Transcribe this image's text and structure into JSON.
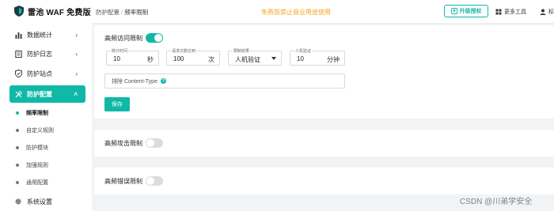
{
  "app": {
    "logo_text": "雷池 WAF 免费版"
  },
  "sidebar": {
    "items": [
      {
        "label": "数据统计",
        "icon": "bar-chart-icon"
      },
      {
        "label": "防护日志",
        "icon": "log-icon"
      },
      {
        "label": "防护站点",
        "icon": "shield-icon"
      },
      {
        "label": "防护配置",
        "icon": "tools-icon"
      },
      {
        "label": "系统设置",
        "icon": "gear-icon"
      }
    ],
    "sub_items": [
      {
        "label": "频率限制"
      },
      {
        "label": "自定义规则"
      },
      {
        "label": "防护模块"
      },
      {
        "label": "加强规则"
      },
      {
        "label": "通用配置"
      }
    ],
    "active_item": "防护配置",
    "active_sub_item": "频率限制",
    "accent": "#10b8a6"
  },
  "header": {
    "breadcrumb": [
      "防护配置",
      "频率限制"
    ],
    "notice": "免费版禁止商业用途使用",
    "upgrade_label": "升级授权",
    "tools_label": "更多工具",
    "more_label": "标"
  },
  "rate_limit": {
    "high_freq": {
      "title": "高频访问限制",
      "enabled": true,
      "period": {
        "label": "统计时间",
        "value": "10",
        "unit": "秒"
      },
      "requests": {
        "label": "请求次数达到",
        "value": "100",
        "unit": "次"
      },
      "action": {
        "label": "限制结果",
        "value": "人机验证"
      },
      "captcha": {
        "label": "人机验证",
        "value": "10",
        "unit": "分钟"
      },
      "exclude_placeholder": "排除 Content-Type",
      "save_label": "保存"
    },
    "attack": {
      "title": "高频攻击限制",
      "enabled": false
    },
    "error": {
      "title": "高频错误限制",
      "enabled": false
    }
  },
  "watermark": "CSDN @川弟学安全"
}
